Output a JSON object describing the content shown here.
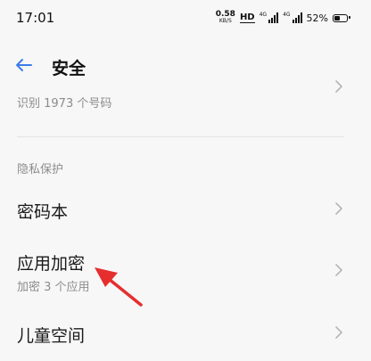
{
  "status_bar": {
    "time": "17:01",
    "net_speed_value": "0.58",
    "net_speed_unit": "KB/S",
    "hd_label": "HD",
    "signal1_tag": "4G",
    "signal2_tag": "4G",
    "battery_percent": "52%",
    "battery_level": 0.52
  },
  "header": {
    "back_icon": "back-arrow-icon",
    "title": "安全"
  },
  "partial_item": {
    "subtitle": "识别 1973 个号码"
  },
  "privacy_section": {
    "header": "隐私保护",
    "items": [
      {
        "title": "密码本",
        "subtitle": ""
      },
      {
        "title": "应用加密",
        "subtitle": "加密 3 个应用"
      },
      {
        "title": "儿童空间",
        "subtitle": ""
      }
    ]
  },
  "colors": {
    "accent": "#3d7de8",
    "annotation": "#e62e2e",
    "chevron": "#b5b5b5"
  }
}
